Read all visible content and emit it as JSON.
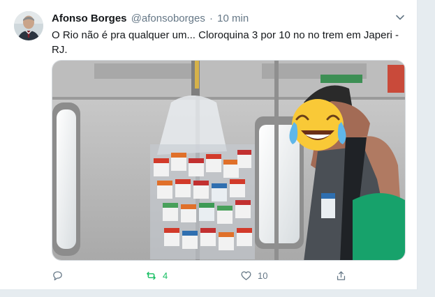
{
  "tweet": {
    "author_name": "Afonso Borges",
    "handle": "@afonsoborges",
    "separator": "·",
    "time": "10 min",
    "text": "O Rio não é pra qualquer um... Cloroquina 3 por 10 no no trem em Japeri - RJ."
  },
  "actions": {
    "retweet_count": "4",
    "like_count": "10"
  },
  "colors": {
    "retweet_active": "#17bf63",
    "muted": "#657786",
    "text": "#14171a"
  }
}
